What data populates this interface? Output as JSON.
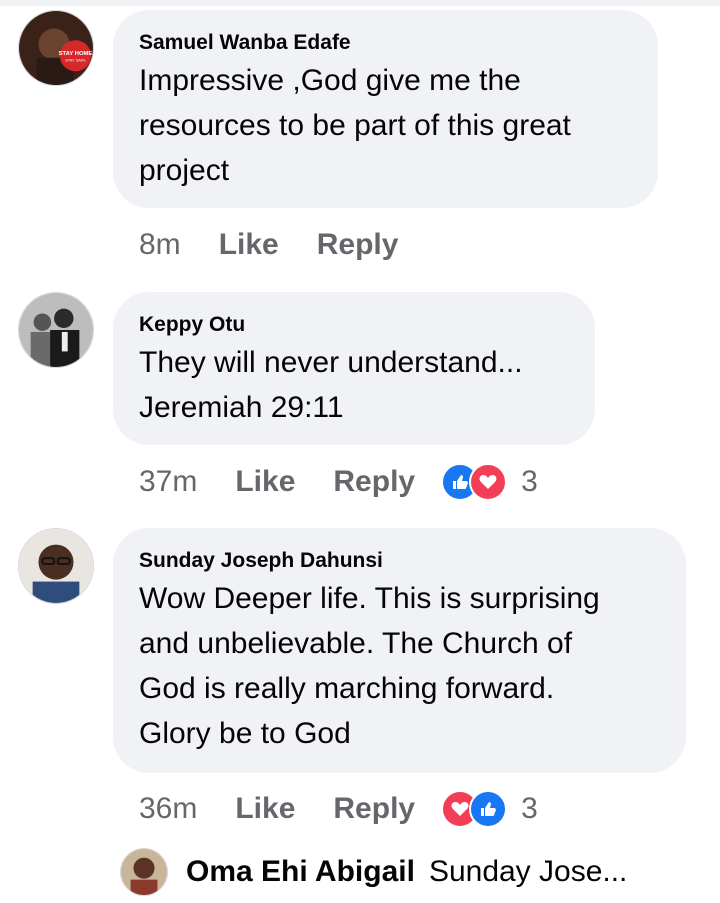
{
  "comments": [
    {
      "author": "Samuel Wanba Edafe",
      "lines": [
        "Impressive ,God give me the",
        "resources to be part of this great",
        "project"
      ],
      "time": "8m",
      "like_label": "Like",
      "reply_label": "Reply",
      "avatar_badge_line1": "STAY HOME",
      "avatar_badge_line2": "STAY SAFE"
    },
    {
      "author": "Keppy Otu",
      "lines": [
        "They will never understand...",
        "Jeremiah 29:11"
      ],
      "time": "37m",
      "like_label": "Like",
      "reply_label": "Reply",
      "reactions": [
        "like",
        "love"
      ],
      "reaction_count": "3"
    },
    {
      "author": "Sunday Joseph Dahunsi",
      "lines": [
        "Wow Deeper life. This is surprising",
        "and unbelievable. The Church of",
        "God is really marching forward.",
        "Glory be to God"
      ],
      "time": "36m",
      "like_label": "Like",
      "reply_label": "Reply",
      "reactions": [
        "love",
        "like"
      ],
      "reaction_count": "3"
    }
  ],
  "reply_preview": {
    "author": "Oma Ehi Abigail",
    "text": "Sunday Jose..."
  },
  "colors": {
    "bubble": "#f0f2f5",
    "meta_text": "#65676b",
    "like_blue": "#1877f2",
    "love_red": "#f33e58"
  }
}
